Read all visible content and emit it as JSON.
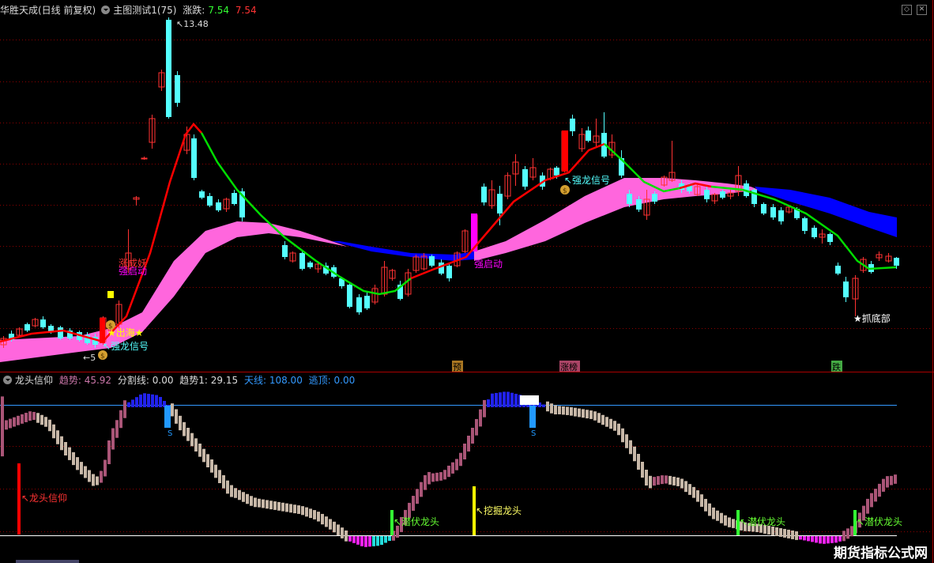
{
  "header": {
    "stock_name": "华胜天成(日线 前复权)",
    "indicator_name": "主图测试1(75)",
    "change_label": "涨跌:",
    "change_value_green": "7.54",
    "change_value_red": "7.54"
  },
  "sub_header": {
    "indicator_name": "龙头信仰",
    "trend_label": "趋势: 45.92",
    "divide_label": "分割线: 0.00",
    "trend1_label": "趋势1: 29.15",
    "sky_label": "天线: 108.00",
    "escape_label": "逃顶: 0.00"
  },
  "annotations": {
    "high_price": "13.48",
    "low_price": "5",
    "strong_dragon_1": "强龙信号",
    "strong_dragon_2": "强龙信号",
    "out_sea": "★出海★",
    "limit_up": "涨成妖",
    "strong_start_1": "强启动",
    "strong_start_2": "强启动",
    "catch_bottom": "★抓底部",
    "tag_yu": "预",
    "tag_zhang": "涨榜",
    "tag_die": "跌",
    "dragon_faith": "龙头信仰",
    "hidden_dragon_1": "潜伏龙头",
    "dig_dragon": "挖掘龙头",
    "hidden_dragon_2": "潜伏龙头",
    "hidden_dragon_3": "潜伏龙头",
    "s_marker_1": "S",
    "s_marker_2": "S"
  },
  "watermark": "期货指标公式网",
  "colors": {
    "up": "#ff3232",
    "down": "#54ffff",
    "ma_up": "#ff0000",
    "ma_down": "#00dd00",
    "cloud_pink": "#ff66dd",
    "cloud_blue": "#0000ff",
    "grid": "#8b0000"
  },
  "icons": [
    "dropdown-icon",
    "money-bag-icon",
    "window-restore-icon",
    "window-close-icon"
  ]
}
